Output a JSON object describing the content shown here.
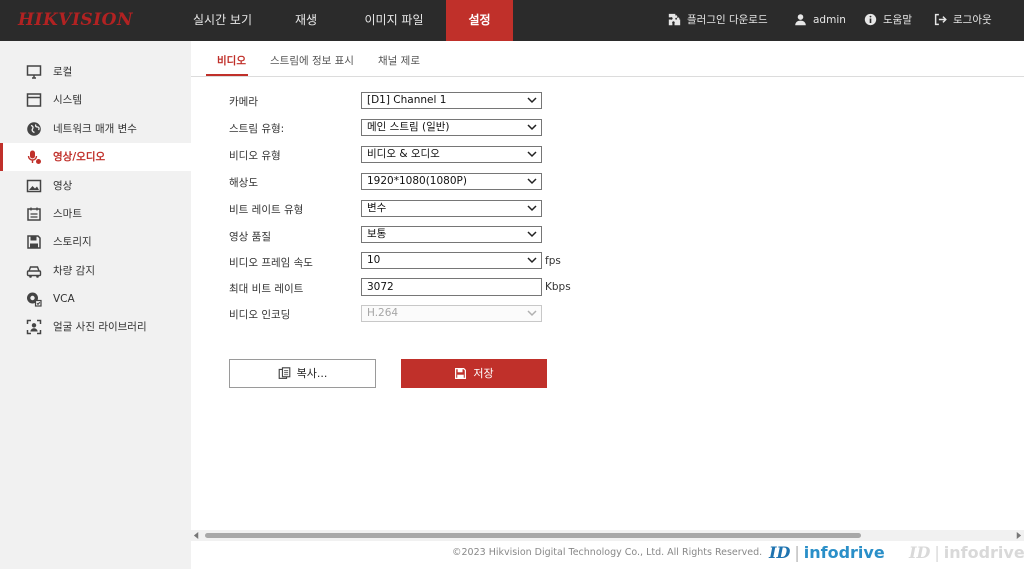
{
  "app": {
    "logo": "HIKVISION"
  },
  "nav": {
    "tabs": [
      {
        "label": "실시간 보기"
      },
      {
        "label": "재생"
      },
      {
        "label": "이미지 파일"
      },
      {
        "label": "설정"
      }
    ],
    "active_tab": "설정",
    "plugin_download": "플러그인 다운로드",
    "user": "admin",
    "help": "도움말",
    "logout": "로그아웃"
  },
  "sidebar": {
    "items": [
      {
        "label": "로컬",
        "icon": "monitor-icon"
      },
      {
        "label": "시스템",
        "icon": "window-icon"
      },
      {
        "label": "네트워크 매개 변수",
        "icon": "globe-icon"
      },
      {
        "label": "영상/오디오",
        "icon": "microphone-icon"
      },
      {
        "label": "영상",
        "icon": "image-icon"
      },
      {
        "label": "스마트",
        "icon": "calendar-icon"
      },
      {
        "label": "스토리지",
        "icon": "floppy-disk-icon"
      },
      {
        "label": "차량 감지",
        "icon": "car-icon"
      },
      {
        "label": "VCA",
        "icon": "vca-camera-icon"
      },
      {
        "label": "얼굴 사진 라이브러리",
        "icon": "face-frame-icon"
      }
    ],
    "active_item": "영상/오디오"
  },
  "subtabs": [
    {
      "label": "비디오"
    },
    {
      "label": "스트림에 정보 표시"
    },
    {
      "label": "채널 제로"
    }
  ],
  "active_subtab": "비디오",
  "form": {
    "camera": {
      "label": "카메라",
      "value": "[D1] Channel 1"
    },
    "stream_type": {
      "label": "스트림 유형:",
      "value": "메인 스트림 (일반)"
    },
    "video_type": {
      "label": "비디오 유형",
      "value": "비디오 & 오디오"
    },
    "resolution": {
      "label": "해상도",
      "value": "1920*1080(1080P)"
    },
    "bitrate_type": {
      "label": "비트 레이트 유형",
      "value": "변수"
    },
    "video_quality": {
      "label": "영상 품질",
      "value": "보통"
    },
    "frame_rate": {
      "label": "비디오 프레임 속도",
      "value": "10",
      "unit": "fps"
    },
    "max_bitrate": {
      "label": "최대 비트 레이트",
      "value": "3072",
      "unit": "Kbps"
    },
    "video_encoding": {
      "label": "비디오 인코딩",
      "value": "H.264"
    }
  },
  "buttons": {
    "copy": "복사...",
    "save": "저장"
  },
  "footer": {
    "copyright": "©2023 Hikvision Digital Technology Co., Ltd. All Rights Reserved.",
    "watermark_id": "ID",
    "watermark_text": "infodrive"
  },
  "colors": {
    "accent": "#c0302a",
    "topbar": "#2b2b2b",
    "sidebar": "#f1f1f1"
  }
}
